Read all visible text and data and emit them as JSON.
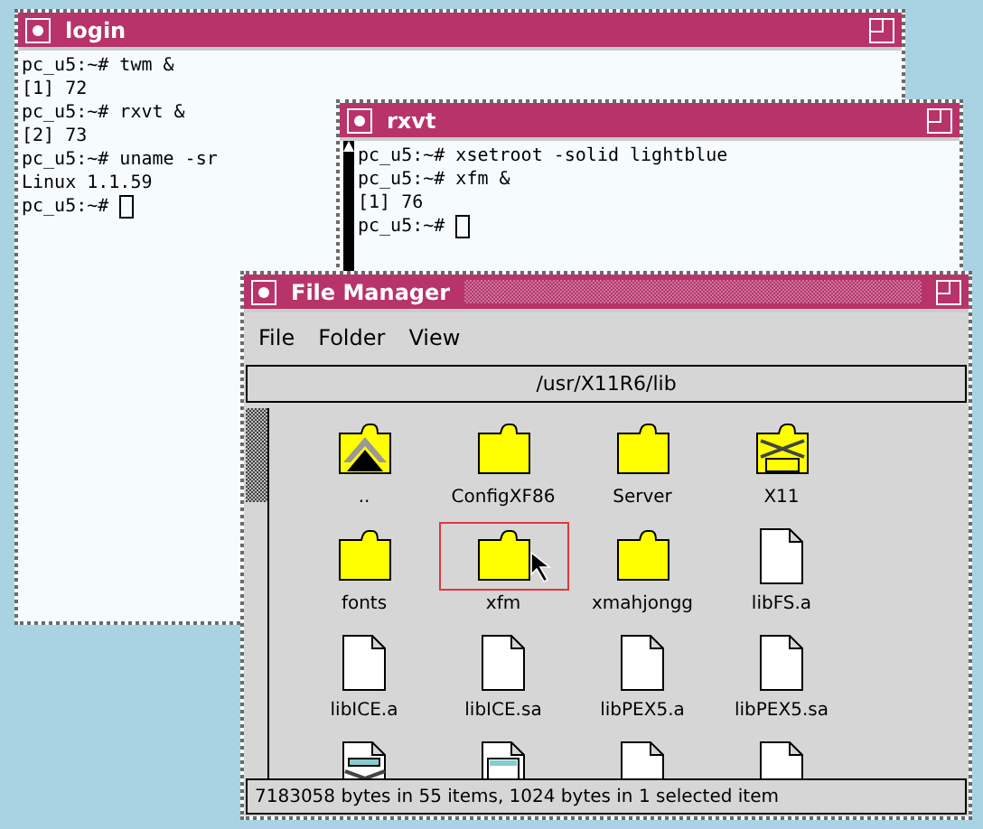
{
  "terminals": [
    {
      "title": "login",
      "active": false,
      "cursor_visible": true,
      "lines": [
        "pc_u5:~# twm &",
        "[1] 72",
        "pc_u5:~# rxvt &",
        "[2] 73",
        "pc_u5:~# uname -sr",
        "Linux 1.1.59",
        "pc_u5:~# "
      ]
    },
    {
      "title": "rxvt",
      "active": false,
      "scrollbar": true,
      "cursor_visible": true,
      "lines": [
        "pc_u5:~# xsetroot -solid lightblue",
        "pc_u5:~# xfm &",
        "[1] 76",
        "pc_u5:~# "
      ]
    }
  ],
  "file_manager": {
    "title": "File Manager",
    "active": true,
    "menu": [
      "File",
      "Folder",
      "View"
    ],
    "path": "/usr/X11R6/lib",
    "items": [
      {
        "kind": "parent",
        "label": "..",
        "selected": false
      },
      {
        "kind": "folder",
        "label": "ConfigXF86",
        "selected": false
      },
      {
        "kind": "folder",
        "label": "Server",
        "selected": false
      },
      {
        "kind": "link",
        "label": "X11",
        "selected": false
      },
      {
        "kind": "folder",
        "label": "fonts",
        "selected": false
      },
      {
        "kind": "folder",
        "label": "xfm",
        "selected": true
      },
      {
        "kind": "folder",
        "label": "xmahjongg",
        "selected": false
      },
      {
        "kind": "file",
        "label": "libFS.a",
        "selected": false
      },
      {
        "kind": "file",
        "label": "libICE.a",
        "selected": false
      },
      {
        "kind": "file",
        "label": "libICE.sa",
        "selected": false
      },
      {
        "kind": "file",
        "label": "libPEX5.a",
        "selected": false
      },
      {
        "kind": "file",
        "label": "libPEX5.sa",
        "selected": false
      },
      {
        "kind": "program-link",
        "selected": false
      },
      {
        "kind": "program",
        "selected": false
      },
      {
        "kind": "file",
        "selected": false
      },
      {
        "kind": "file",
        "selected": false
      }
    ],
    "status": "7183058 bytes in 55 items, 1024 bytes in 1 selected item"
  }
}
